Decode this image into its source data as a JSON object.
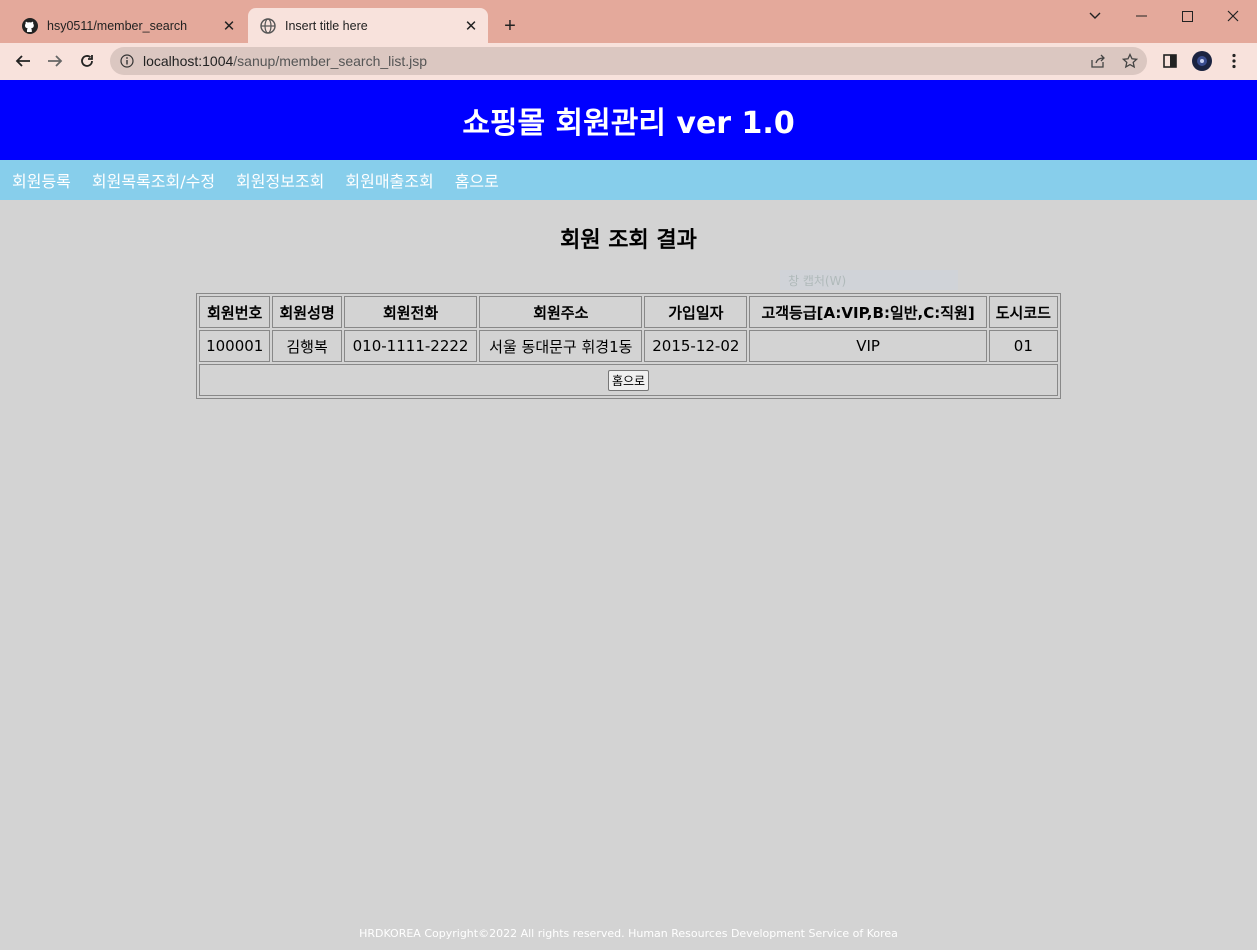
{
  "browser": {
    "tabs": [
      {
        "title": "hsy0511/member_search",
        "icon": "github-icon"
      },
      {
        "title": "Insert title here",
        "icon": "globe-icon"
      }
    ],
    "new_tab": "+",
    "url_host": "localhost:1004",
    "url_path": "/sanup/member_search_list.jsp"
  },
  "page": {
    "header_title": "쇼핑몰 회원관리 ver 1.0",
    "nav": [
      "회원등록",
      "회원목록조회/수정",
      "회원정보조회",
      "회원매출조회",
      "홈으로"
    ],
    "section_title": "회원 조회 결과",
    "overlay_text": "창 캡처(W)",
    "table": {
      "headers": [
        "회원번호",
        "회원성명",
        "회원전화",
        "회원주소",
        "가입일자",
        "고객등급[A:VIP,B:일반,C:직원]",
        "도시코드"
      ],
      "rows": [
        [
          "100001",
          "김행복",
          "010-1111-2222",
          "서울 동대문구 휘경1동",
          "2015-12-02",
          "VIP",
          "01"
        ]
      ],
      "home_button": "홈으로"
    },
    "footer": "HRDKOREA Copyright©2022 All rights reserved. Human Resources Development Service of Korea"
  }
}
